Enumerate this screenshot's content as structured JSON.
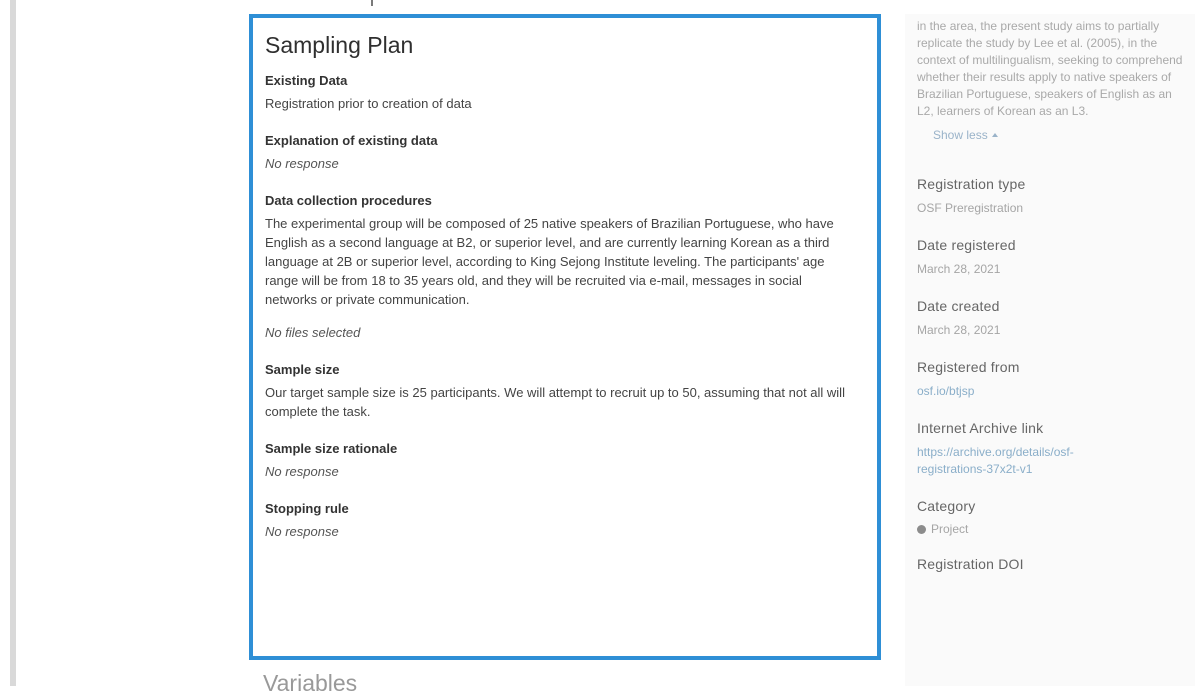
{
  "sampling_plan": {
    "title": "Sampling Plan",
    "fields": [
      {
        "label": "Existing Data",
        "value": "Registration prior to creation of data"
      },
      {
        "label": "Explanation of existing data",
        "value": "No response"
      },
      {
        "label": "Data collection procedures",
        "value": "The experimental group will be composed of 25  native speakers of Brazilian Portuguese, who have English as a second language at B2, or superior level, and are currently learning Korean as a third language at 2B or superior level, according to King Sejong Institute leveling. The participants' age range will be from 18 to 35 years old, and they will be recruited via e-mail, messages in social networks or private communication.",
        "files": "No files selected"
      },
      {
        "label": "Sample size",
        "value": "Our target sample size is 25 participants. We will attempt to recruit up to 50, assuming that not all will complete the task."
      },
      {
        "label": "Sample size rationale",
        "value": "No response"
      },
      {
        "label": "Stopping rule",
        "value": "No response"
      }
    ],
    "next_section_title": "Variables"
  },
  "sidebar": {
    "description_tail": "in the area, the present study aims to partially replicate the study by Lee et al. (2005), in the context of multilingualism, seeking to comprehend whether their results apply to native speakers of Brazilian Portuguese, speakers of English as an L2, learners of Korean as an L3.",
    "show_less": "Show less",
    "registration_type": {
      "label": "Registration type",
      "value": "OSF Preregistration"
    },
    "date_registered": {
      "label": "Date registered",
      "value": "March 28, 2021"
    },
    "date_created": {
      "label": "Date created",
      "value": "March 28, 2021"
    },
    "registered_from": {
      "label": "Registered from",
      "value": "osf.io/btjsp"
    },
    "internet_archive": {
      "label": "Internet Archive link",
      "value": "https://archive.org/details/osf-registrations-37x2t-v1"
    },
    "category": {
      "label": "Category",
      "value": "Project",
      "icon": "cube-icon"
    },
    "registration_doi": {
      "label": "Registration DOI"
    }
  },
  "colors": {
    "accent_border": "#2e8fd6",
    "link": "#8aaec9"
  }
}
